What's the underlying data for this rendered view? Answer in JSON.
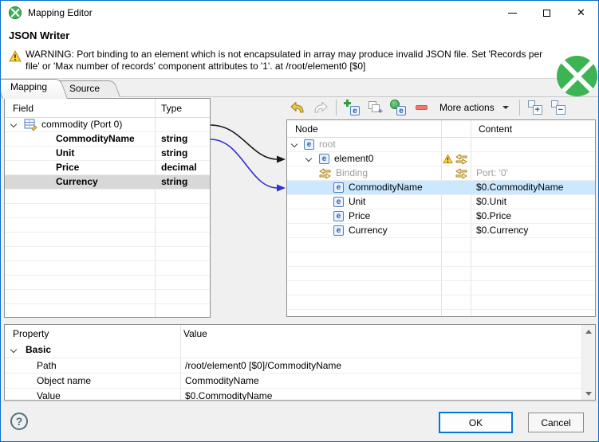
{
  "window": {
    "title": "Mapping Editor",
    "close_glyph": "✕"
  },
  "header": {
    "title": "JSON Writer",
    "warning_text": "WARNING: Port binding to an element which is not encapsulated in array may produce invalid JSON file. Set 'Records per file' or 'Max number of records' component attributes to '1'. at /root/element0 [$0]"
  },
  "tabs": {
    "mapping": "Mapping",
    "source": "Source"
  },
  "field_table": {
    "col_field": "Field",
    "col_type": "Type",
    "root_label": "commodity (Port 0)",
    "rows": [
      {
        "field": "CommodityName",
        "type": "string"
      },
      {
        "field": "Unit",
        "type": "string"
      },
      {
        "field": "Price",
        "type": "decimal"
      },
      {
        "field": "Currency",
        "type": "string"
      }
    ],
    "selected_field": "Currency"
  },
  "toolbar": {
    "more_actions": "More actions",
    "icons": [
      "undo-icon",
      "redo-icon",
      "add-element-icon",
      "add-sibling-element-icon",
      "add-wildcard-element-icon",
      "remove-icon",
      "expand-all-icon",
      "collapse-all-icon"
    ]
  },
  "node_table": {
    "col_node": "Node",
    "col_content": "Content",
    "rows": [
      {
        "label": "root",
        "content": ""
      },
      {
        "label": "element0",
        "content": ""
      },
      {
        "label": "Binding",
        "content": "Port: '0'"
      },
      {
        "label": "CommodityName",
        "content": "$0.CommodityName"
      },
      {
        "label": "Unit",
        "content": "$0.Unit"
      },
      {
        "label": "Price",
        "content": "$0.Price"
      },
      {
        "label": "Currency",
        "content": "$0.Currency"
      }
    ],
    "selected_node": "CommodityName"
  },
  "property_panel": {
    "col_property": "Property",
    "col_value": "Value",
    "group_label": "Basic",
    "rows": [
      {
        "property": "Path",
        "value": "/root/element0 [$0]/CommodityName"
      },
      {
        "property": "Object name",
        "value": "CommodityName"
      },
      {
        "property": "Value",
        "value": "$0.CommodityName"
      }
    ]
  },
  "footer": {
    "ok_label": "OK",
    "cancel_label": "Cancel"
  },
  "colors": {
    "accent_blue": "#0078d7",
    "clover_green": "#3cb454",
    "selection_blue": "#cbe8ff",
    "selection_gray": "#d8d8d8",
    "warning_yellow": "#ffd43d",
    "binding_gold": "#b8860b"
  }
}
